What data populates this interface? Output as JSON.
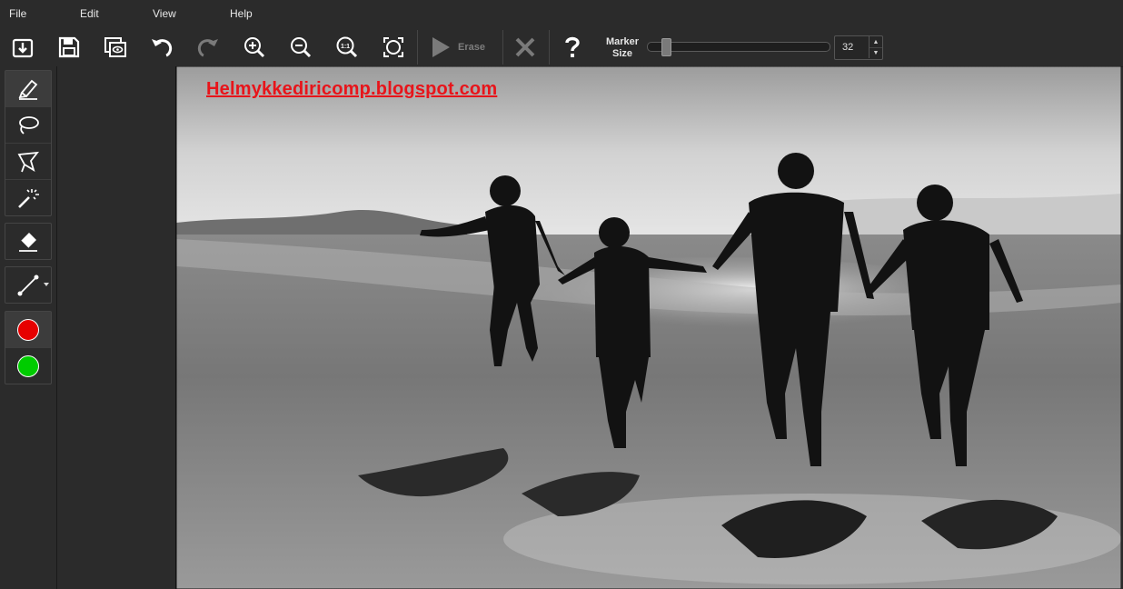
{
  "menu": {
    "file": "File",
    "edit": "Edit",
    "view": "View",
    "help": "Help"
  },
  "toolbar": {
    "buttons": [
      {
        "name": "open-icon"
      },
      {
        "name": "save-icon"
      },
      {
        "name": "preview-icon"
      },
      {
        "name": "undo-icon"
      },
      {
        "name": "redo-icon"
      },
      {
        "name": "zoom-in-icon"
      },
      {
        "name": "zoom-out-icon"
      },
      {
        "name": "actual-size-icon"
      },
      {
        "name": "fit-screen-icon"
      }
    ],
    "erase_label": "Erase",
    "marker_label_line1": "Marker",
    "marker_label_line2": "Size",
    "marker_size": "32",
    "marker_size_fraction": 0.08
  },
  "tools": {
    "group1": [
      "marker-tool-icon",
      "lasso-tool-icon",
      "polygon-lasso-tool-icon",
      "magic-wand-tool-icon"
    ],
    "group2": [
      "eraser-tool-icon"
    ],
    "group3": [
      "line-tool-icon"
    ],
    "colors": {
      "foreground": "#e60000",
      "background": "#00cc00"
    }
  },
  "canvas": {
    "watermark": "Helmykkediricomp.blogspot.com"
  }
}
